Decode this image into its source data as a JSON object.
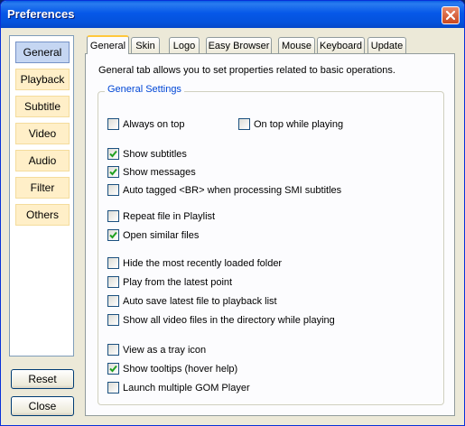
{
  "window": {
    "title": "Preferences",
    "close_icon": "close-icon"
  },
  "sidebar": {
    "items": [
      {
        "label": "General",
        "active": true
      },
      {
        "label": "Playback",
        "active": false
      },
      {
        "label": "Subtitle",
        "active": false
      },
      {
        "label": "Video",
        "active": false
      },
      {
        "label": "Audio",
        "active": false
      },
      {
        "label": "Filter",
        "active": false
      },
      {
        "label": "Others",
        "active": false
      }
    ],
    "reset_label": "Reset",
    "close_label": "Close"
  },
  "tabs": [
    {
      "label": "General",
      "active": true
    },
    {
      "label": "Skin",
      "active": false
    },
    {
      "label": "Logo",
      "active": false
    },
    {
      "label": "Easy Browser",
      "active": false
    },
    {
      "label": "Mouse",
      "active": false
    },
    {
      "label": "Keyboard",
      "active": false
    },
    {
      "label": "Update",
      "active": false
    }
  ],
  "general": {
    "description": "General tab allows you to set properties related to basic operations.",
    "group_title": "General Settings",
    "options": [
      {
        "label": "Always on top",
        "checked": false
      },
      {
        "label": "On top while playing",
        "checked": false
      },
      {
        "label": "Show subtitles",
        "checked": true
      },
      {
        "label": "Show messages",
        "checked": true
      },
      {
        "label": "Auto tagged <BR> when processing SMI subtitles",
        "checked": false
      },
      {
        "label": "Repeat file in Playlist",
        "checked": false
      },
      {
        "label": "Open similar files",
        "checked": true
      },
      {
        "label": "Hide the most recently loaded folder",
        "checked": false
      },
      {
        "label": "Play from the latest point",
        "checked": false
      },
      {
        "label": "Auto save latest file to playback list",
        "checked": false
      },
      {
        "label": "Show all video files in the directory while playing",
        "checked": false
      },
      {
        "label": "View as a tray icon",
        "checked": false
      },
      {
        "label": "Show tooltips (hover help)",
        "checked": true
      },
      {
        "label": "Launch multiple GOM Player",
        "checked": false
      }
    ]
  }
}
